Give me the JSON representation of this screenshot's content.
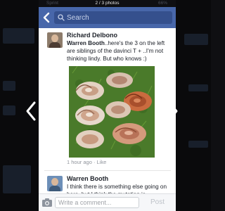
{
  "viewer": {
    "photo_counter": "2 / 3 photos",
    "status_ghost_left": "Sprint",
    "status_ghost_right": "66%"
  },
  "header": {
    "search_placeholder": "Search"
  },
  "comments": [
    {
      "author": "Richard Delbono",
      "tagged_name": "Warren Booth",
      "text": "..here's the 3 on the left are siblings of the davinci T + ..I'm not thinking lindy. But who knows :)"
    },
    {
      "author": "Warren Booth",
      "text": "I think there is something else going on here, but I think the mutation is"
    }
  ],
  "meta": {
    "time": "1 hour ago",
    "separator": " · ",
    "like_label": "Like"
  },
  "composer": {
    "placeholder": "Write a comment...",
    "post_label": "Post"
  },
  "colors": {
    "facebook_blue": "#4867aa",
    "search_box": "#35508d",
    "meta_grey": "#90949c"
  }
}
